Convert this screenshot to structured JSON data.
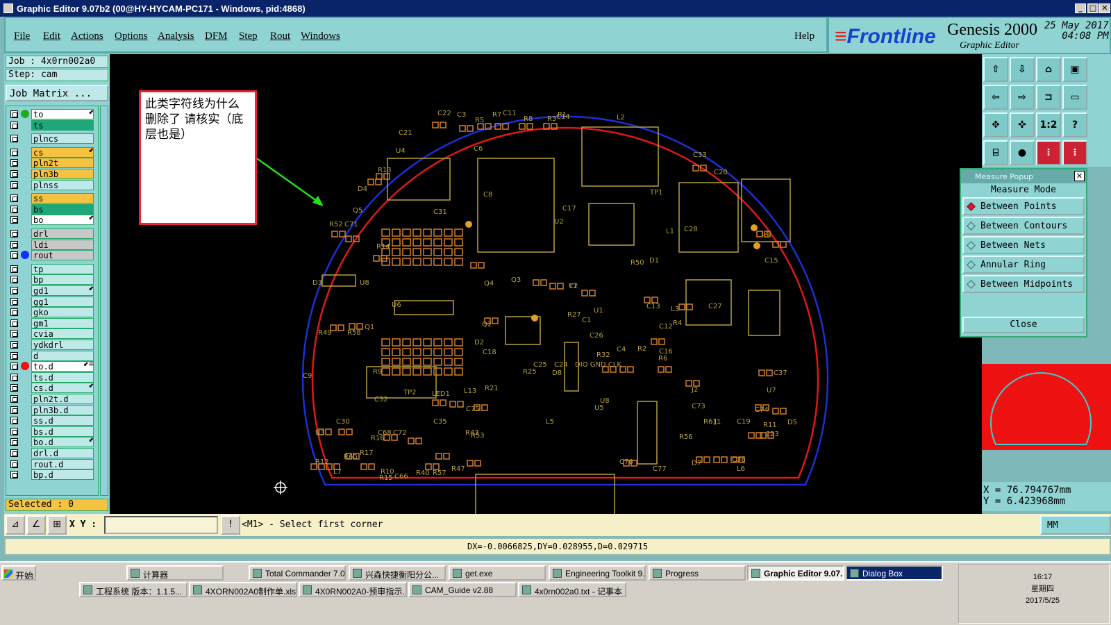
{
  "window": {
    "title": "Graphic Editor 9.07b2 (00@HY-HYCAM-PC171 - Windows, pid:4868)"
  },
  "menu": {
    "items": [
      "File",
      "Edit",
      "Actions",
      "Options",
      "Analysis",
      "DFM",
      "Step",
      "Rout",
      "Windows"
    ],
    "help": "Help"
  },
  "brand": {
    "logo": "Frontline",
    "product": "Genesis 2000",
    "subtitle": "Graphic Editor",
    "date": "25 May 2017",
    "time": "04:08 PM"
  },
  "job": {
    "job_label": "Job : 4x0rn002a0",
    "step_label": "Step: cam",
    "matrix_button": "Job Matrix ..."
  },
  "layers": [
    {
      "name": "to",
      "bg": "#ffffff",
      "dot": "#22aa22",
      "mark": "⬋"
    },
    {
      "name": "ts",
      "bg": "#1fa77a",
      "dot": "",
      "mark": ""
    },
    {
      "name": "plncs",
      "bg": "#bfe9e9",
      "dot": "",
      "mark": ""
    },
    {
      "name": "cs",
      "bg": "#f5c242",
      "dot": "",
      "mark": "⬋"
    },
    {
      "name": "pln2t",
      "bg": "#f5c242",
      "dot": "",
      "mark": ""
    },
    {
      "name": "pln3b",
      "bg": "#f5c242",
      "dot": "",
      "mark": ""
    },
    {
      "name": "plnss",
      "bg": "#bfe9e9",
      "dot": "",
      "mark": ""
    },
    {
      "name": "ss",
      "bg": "#f5c242",
      "dot": "",
      "mark": ""
    },
    {
      "name": "bs",
      "bg": "#1fa77a",
      "dot": "",
      "mark": ""
    },
    {
      "name": "bo",
      "bg": "#ffffff",
      "dot": "",
      "mark": "⬋"
    },
    {
      "name": "drl",
      "bg": "#c8c8c8",
      "dot": "",
      "mark": ""
    },
    {
      "name": "ldi",
      "bg": "#c8c8c8",
      "dot": "",
      "mark": ""
    },
    {
      "name": "rout",
      "bg": "#c8c8c8",
      "dot": "#1030ff",
      "mark": ""
    },
    {
      "name": "tp",
      "bg": "#bfe9e9",
      "dot": "",
      "mark": ""
    },
    {
      "name": "bp",
      "bg": "#bfe9e9",
      "dot": "",
      "mark": ""
    },
    {
      "name": "gd1",
      "bg": "#bfe9e9",
      "dot": "",
      "mark": "⬋"
    },
    {
      "name": "gg1",
      "bg": "#bfe9e9",
      "dot": "",
      "mark": ""
    },
    {
      "name": "gko",
      "bg": "#bfe9e9",
      "dot": "",
      "mark": ""
    },
    {
      "name": "gm1",
      "bg": "#bfe9e9",
      "dot": "",
      "mark": ""
    },
    {
      "name": "cvia",
      "bg": "#bfe9e9",
      "dot": "",
      "mark": ""
    },
    {
      "name": "ydkdrl",
      "bg": "#bfe9e9",
      "dot": "",
      "mark": ""
    },
    {
      "name": "d",
      "bg": "#bfe9e9",
      "dot": "",
      "mark": ""
    },
    {
      "name": "to.d",
      "bg": "#ffffff",
      "dot": "#ee1111",
      "mark": "⬋≡"
    },
    {
      "name": "ts.d",
      "bg": "#bfe9e9",
      "dot": "",
      "mark": ""
    },
    {
      "name": "cs.d",
      "bg": "#bfe9e9",
      "dot": "",
      "mark": "⬋"
    },
    {
      "name": "pln2t.d",
      "bg": "#bfe9e9",
      "dot": "",
      "mark": ""
    },
    {
      "name": "pln3b.d",
      "bg": "#bfe9e9",
      "dot": "",
      "mark": ""
    },
    {
      "name": "ss.d",
      "bg": "#bfe9e9",
      "dot": "",
      "mark": ""
    },
    {
      "name": "bs.d",
      "bg": "#bfe9e9",
      "dot": "",
      "mark": ""
    },
    {
      "name": "bo.d",
      "bg": "#bfe9e9",
      "dot": "",
      "mark": "⬋"
    },
    {
      "name": "drl.d",
      "bg": "#bfe9e9",
      "dot": "",
      "mark": ""
    },
    {
      "name": "rout.d",
      "bg": "#bfe9e9",
      "dot": "",
      "mark": ""
    },
    {
      "name": "bp.d",
      "bg": "#bfe9e9",
      "dot": "",
      "mark": ""
    }
  ],
  "selected": "Selected : 0",
  "annotation": {
    "note": "此类字符线为什么删除了 请核实（底层也是）"
  },
  "pcb_labels": [
    "C22",
    "C3",
    "R5",
    "R7",
    "C11",
    "R8",
    "R3",
    "R1",
    "C14",
    "L2",
    "C21",
    "U4",
    "C6",
    "R13",
    "D4",
    "C8",
    "C33",
    "C20",
    "Q5",
    "C31",
    "U2",
    "C17",
    "TP1",
    "R52",
    "C71",
    "C28",
    "L1",
    "L4",
    "R14",
    "R50",
    "D1",
    "C15",
    "D3",
    "U8",
    "Q4",
    "Q3",
    "Y1",
    "C2",
    "U6",
    "R27",
    "U1",
    "C13",
    "L3",
    "C27",
    "R49",
    "R58",
    "Q1",
    "Q2",
    "C1",
    "C12",
    "R4",
    "D2",
    "R32",
    "C4",
    "R2",
    "C16",
    "R6",
    "R9",
    "C18",
    "R21",
    "R25",
    "D8",
    "U5",
    "J2",
    "C9",
    "C37",
    "U7",
    "C32",
    "TP2",
    "LED1",
    "L13",
    "C75",
    "U8",
    "C73",
    "C74",
    "D5",
    "U3",
    "C30",
    "R16",
    "C68",
    "C72",
    "C35",
    "R43",
    "L5",
    "R61",
    "J1",
    "C19",
    "R11",
    "C23",
    "R12",
    "R17",
    "R15",
    "C66",
    "R53",
    "R56",
    "L7",
    "R60",
    "R10",
    "R40",
    "R57",
    "R47",
    "C76",
    "C77",
    "D7",
    "C36",
    "L6",
    "C26",
    "C25",
    "C24",
    "DIO GND CLK"
  ],
  "measure": {
    "title": "Measure Popup",
    "mode_label": "Measure Mode",
    "options": [
      "Between Points",
      "Between Contours",
      "Between Nets",
      "Annular Ring",
      "Between Midpoints"
    ],
    "close": "Close"
  },
  "coords": {
    "x": "X = 76.794767mm",
    "y": "Y = 6.423968mm"
  },
  "command": {
    "xy_label": "X Y :",
    "message": "<M1> - Select first corner",
    "units": "MM"
  },
  "status": "DX=-0.0066825,DY=0.028955,D=0.029715",
  "taskbar": {
    "start": "开始",
    "row1": [
      "计算器",
      "Total Commander 7.0...",
      "兴森快捷衡阳分公...",
      "get.exe",
      "Engineering Toolkit 9....",
      "Progress",
      "Graphic Editor 9.07...",
      "Dialog Box"
    ],
    "row2": [
      "工程系统  版本：1.1.5...",
      "4XORN002A0制作单.xls ...",
      "4X0RN002A0-预审指示....",
      "CAM_Guide v2.88",
      "4x0rn002a0.txt - 记事本"
    ],
    "clock_time": "16:17",
    "clock_day": "星期四",
    "clock_date": "2017/5/25"
  },
  "colors": {
    "board_outline_blue": "#1a2fd6",
    "board_outline_red": "#e01818",
    "silk": "#b8a040",
    "pad": "#d4802a"
  }
}
